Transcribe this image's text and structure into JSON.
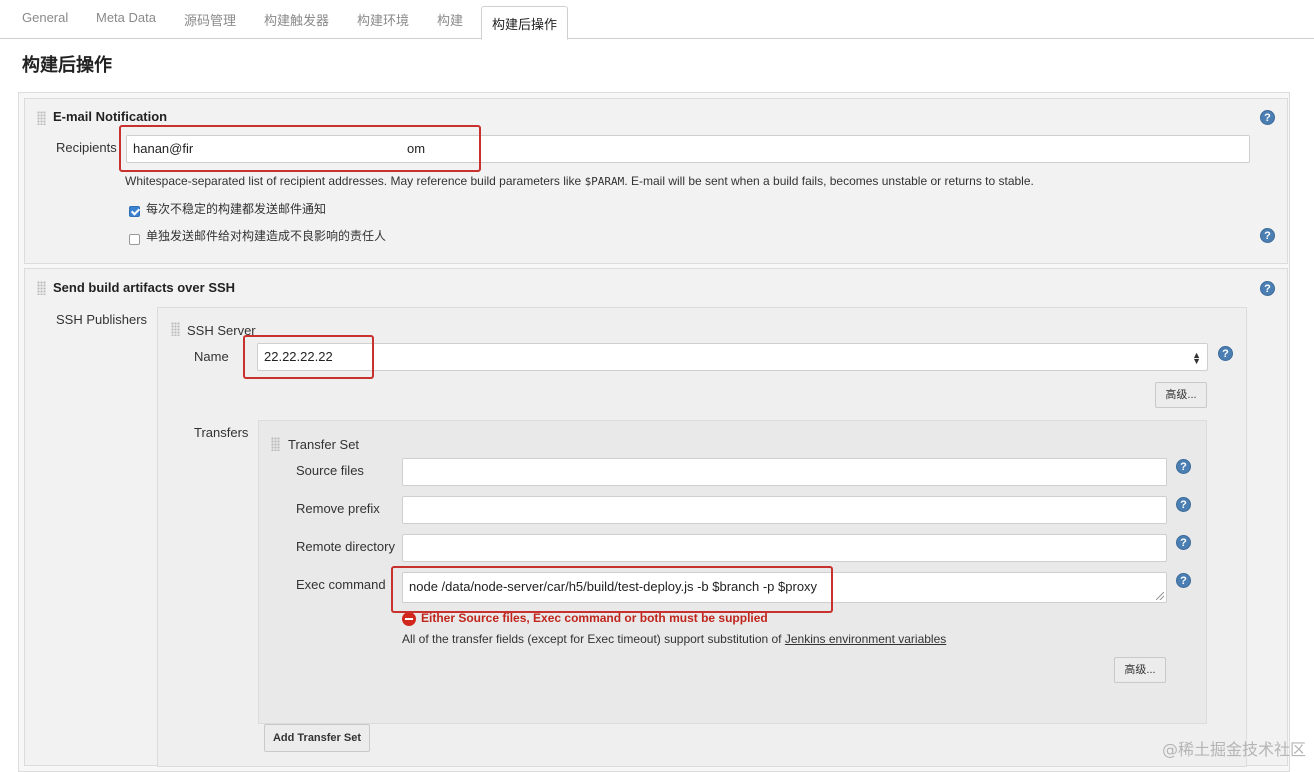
{
  "tabs": [
    "General",
    "Meta Data",
    "源码管理",
    "构建触发器",
    "构建环境",
    "构建",
    "构建后操作"
  ],
  "page_title": "构建后操作",
  "email": {
    "title": "E-mail Notification",
    "recipients_label": "Recipients",
    "recipients_value": "hanan@fir",
    "recipients_value_tail": "om",
    "description_before": "Whitespace-separated list of recipient addresses. May reference build parameters like ",
    "description_param": "$PARAM",
    "description_after": ". E-mail will be sent when a build fails, becomes unstable or returns to stable.",
    "checkbox1_label": "每次不稳定的构建都发送邮件通知",
    "checkbox1_checked": true,
    "checkbox2_label": "单独发送邮件给对构建造成不良影响的责任人",
    "checkbox2_checked": false
  },
  "ssh": {
    "title": "Send build artifacts over SSH",
    "publishers_label": "SSH Publishers",
    "server_title": "SSH Server",
    "name_label": "Name",
    "name_value": "22.22.22.22",
    "advanced_label": "高级...",
    "transfers_label": "Transfers",
    "transfer_set_title": "Transfer Set",
    "source_files_label": "Source files",
    "source_files_value": "",
    "remove_prefix_label": "Remove prefix",
    "remove_prefix_value": "",
    "remote_directory_label": "Remote directory",
    "remote_directory_value": "",
    "exec_command_label": "Exec command",
    "exec_command_value": "node /data/node-server/car/h5/build/test-deploy.js -b $branch -p $proxy",
    "error_text": "Either Source files, Exec command or both must be supplied",
    "info_text": "All of the transfer fields (except for Exec timeout) support substitution of ",
    "info_link": "Jenkins environment variables",
    "transfer_advanced_label": "高级...",
    "add_transfer_set_label": "Add Transfer Set"
  },
  "help_glyph": "?",
  "watermark": "@稀土掘金技术社区",
  "colors": {
    "highlight": "#c8322e",
    "error": "#c0251c",
    "help": "#4b7fb3",
    "checkbox": "#3b82d1"
  }
}
